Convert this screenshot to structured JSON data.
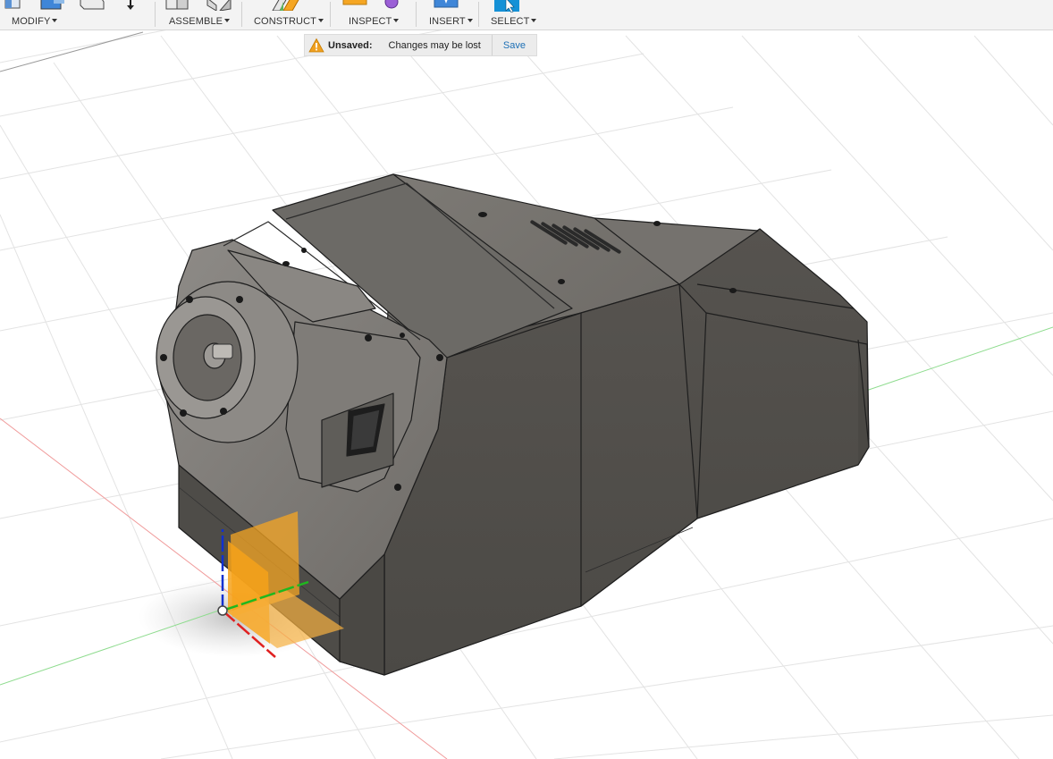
{
  "toolbar": {
    "groups": [
      {
        "id": "modify",
        "label": "MODIFY"
      },
      {
        "id": "assemble",
        "label": "ASSEMBLE"
      },
      {
        "id": "construct",
        "label": "CONSTRUCT"
      },
      {
        "id": "inspect",
        "label": "INSPECT"
      },
      {
        "id": "insert",
        "label": "INSERT"
      },
      {
        "id": "select",
        "label": "SELECT"
      }
    ]
  },
  "notice": {
    "status": "Unsaved:",
    "message": "Changes may be lost",
    "save_label": "Save",
    "icon": "warning-icon"
  },
  "colors": {
    "warning": "#f0a020",
    "select_blue": "#1591d6",
    "body_gray": "#5b5853",
    "plane_orange": "#f5a623",
    "axis_x": "#e02020",
    "axis_y": "#1fb81f",
    "axis_z": "#1030d0"
  }
}
